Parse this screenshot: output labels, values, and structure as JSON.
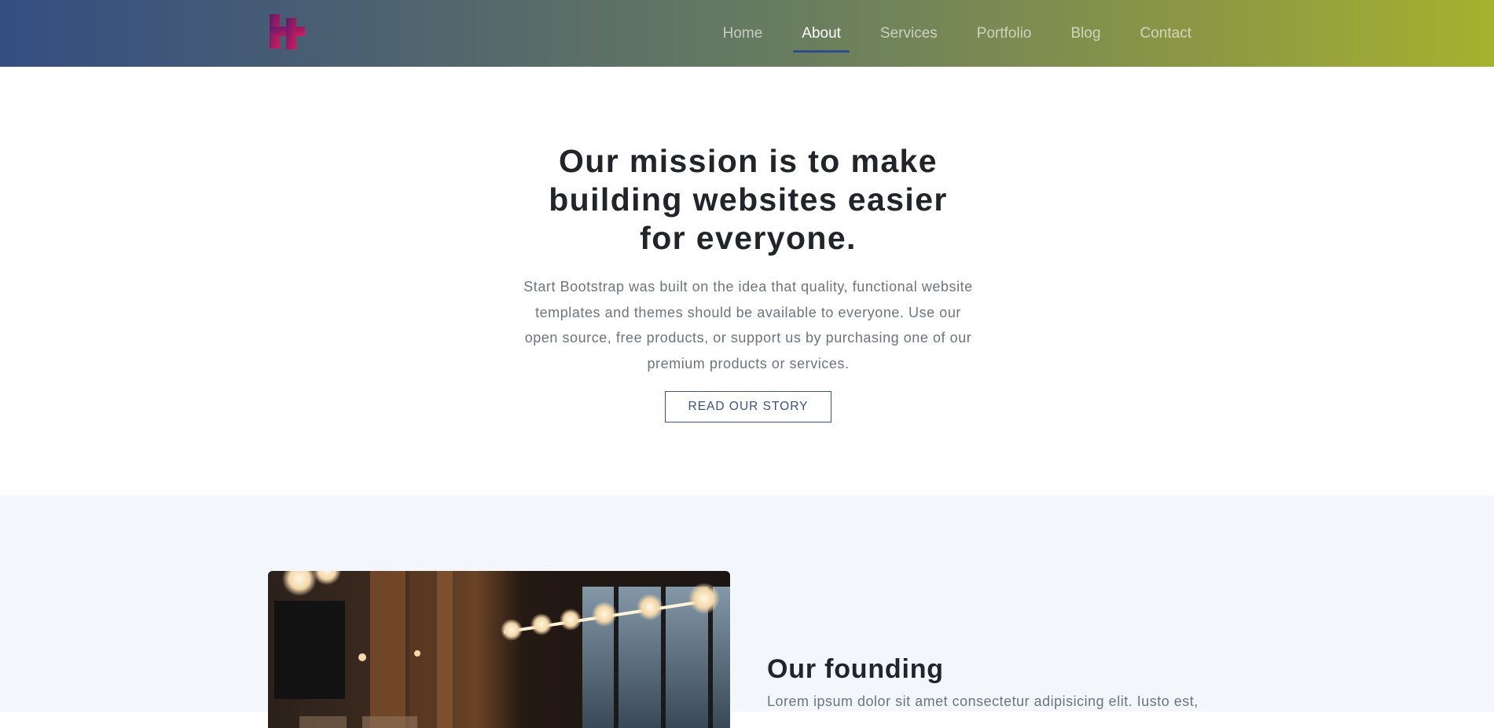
{
  "navbar": {
    "logo_icon": "plus-h-logo-icon",
    "links": [
      {
        "label": "Home",
        "active": false
      },
      {
        "label": "About",
        "active": true
      },
      {
        "label": "Services",
        "active": false
      },
      {
        "label": "Portfolio",
        "active": false
      },
      {
        "label": "Blog",
        "active": false
      },
      {
        "label": "Contact",
        "active": false
      }
    ],
    "active_indicator_color": "#2f4d8d"
  },
  "hero": {
    "title": "Our mission is to make building websites easier for everyone.",
    "text": "Start Bootstrap was built on the idea that quality, functional website templates and themes should be available to everyone. Use our open source, free products, or support us by purchasing one of our premium products or services.",
    "button_label": "Read our story"
  },
  "founding": {
    "title": "Our founding",
    "text": "Lorem ipsum dolor sit amet consectetur adipisicing elit. Iusto est,"
  },
  "colors": {
    "accent": "#3a5284",
    "section_bg": "#f3f7fc",
    "muted_text": "#6c757d",
    "heading_text": "#212529"
  }
}
